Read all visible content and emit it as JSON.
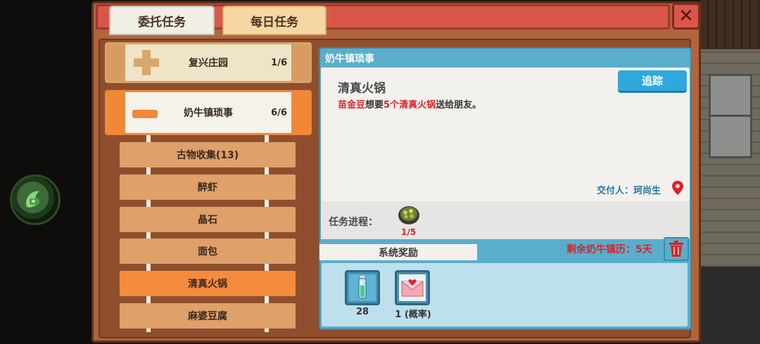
{
  "tabs": {
    "commission": "委托任务",
    "daily": "每日任务"
  },
  "close_symbol": "✕",
  "quest_groups": [
    {
      "label": "复兴庄园",
      "count": "1/6"
    },
    {
      "label": "奶牛镇琐事",
      "count": "6/6"
    }
  ],
  "sub_quests": [
    "古物收集(13)",
    "醉虾",
    "晶石",
    "面包",
    "清真火锅",
    "麻婆豆腐"
  ],
  "detail": {
    "group_title": "奶牛镇琐事",
    "quest_name": "清真火锅",
    "desc_name": "苗金豆",
    "desc_mid": "想要",
    "desc_item": "5个清真火锅",
    "desc_end": "送给朋友。",
    "track_label": "追踪",
    "deliver_label": "交付人：珂尚生",
    "progress_label": "任务进程：",
    "progress_count": "1/5",
    "reward_tab": "系统奖励",
    "remaining": "剩余奶牛镇历：5天"
  },
  "rewards": [
    {
      "icon": "potion-bottle-icon",
      "qty": "28"
    },
    {
      "icon": "love-letter-icon",
      "qty": "1 (概率)"
    }
  ],
  "colors": {
    "title_bar": "#d9574a",
    "frame": "#b0653c",
    "accent_orange": "#f08838",
    "detail_blue": "#5aaecb",
    "track_button": "#2fa9dc",
    "highlight_red": "#e02128"
  }
}
